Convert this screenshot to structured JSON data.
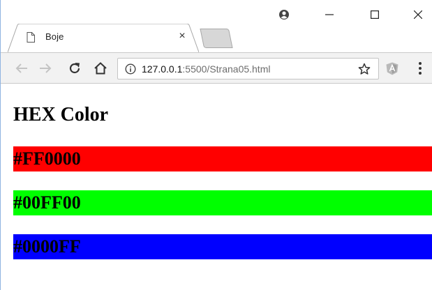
{
  "browser": {
    "tab": {
      "title": "Boje",
      "close_glyph": "×",
      "favicon": "page-icon"
    },
    "window_controls": {
      "profile": "profile-icon",
      "minimize": "minimize-icon",
      "maximize": "maximize-icon",
      "close": "close-icon"
    },
    "toolbar": {
      "back": "back-arrow-icon",
      "forward": "forward-arrow-icon",
      "reload": "reload-icon",
      "home": "home-icon",
      "url_host": "127.0.0.1",
      "url_rest": ":5500/Strana05.html",
      "star": "star-icon",
      "extension": "angular-extension-icon",
      "menu": "kebab-menu-icon"
    }
  },
  "page": {
    "heading": "HEX Color",
    "colors": [
      {
        "label": "#FF0000",
        "background": "#FF0000"
      },
      {
        "label": "#00FF00",
        "background": "#00FF00"
      },
      {
        "label": "#0000FF",
        "background": "#0000FF"
      }
    ]
  }
}
